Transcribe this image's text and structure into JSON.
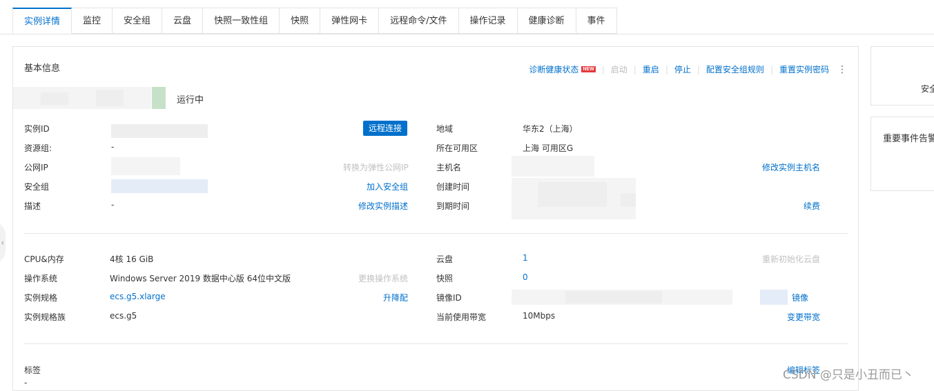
{
  "tabs": [
    {
      "label": "实例详情",
      "active": true
    },
    {
      "label": "监控"
    },
    {
      "label": "安全组"
    },
    {
      "label": "云盘"
    },
    {
      "label": "快照一致性组"
    },
    {
      "label": "快照"
    },
    {
      "label": "弹性网卡"
    },
    {
      "label": "远程命令/文件"
    },
    {
      "label": "操作记录"
    },
    {
      "label": "健康诊断"
    },
    {
      "label": "事件"
    }
  ],
  "panel": {
    "title": "基本信息",
    "actions": {
      "diagnose": "诊断健康状态",
      "new_badge": "NEW",
      "start": "启动",
      "restart": "重启",
      "stop": "停止",
      "config_sg": "配置安全组规则",
      "reset_pwd": "重置实例密码"
    },
    "status": "运行中",
    "basic_left": {
      "instance_id": {
        "label": "实例ID",
        "button": "远程连接"
      },
      "resource_group": {
        "label": "资源组:",
        "value": "-"
      },
      "public_ip": {
        "label": "公网IP",
        "action": "转换为弹性公网IP"
      },
      "security_group": {
        "label": "安全组",
        "action": "加入安全组"
      },
      "description": {
        "label": "描述",
        "value": "-",
        "action": "修改实例描述"
      }
    },
    "basic_right": {
      "region": {
        "label": "地域",
        "value": "华东2（上海）"
      },
      "zone": {
        "label": "所在可用区",
        "value": "上海 可用区G"
      },
      "hostname": {
        "label": "主机名",
        "action": "修改实例主机名"
      },
      "created": {
        "label": "创建时间"
      },
      "expire": {
        "label": "到期时间",
        "action": "续费"
      }
    },
    "spec_left": {
      "cpu_mem": {
        "label": "CPU&内存",
        "value": "4核 16 GiB"
      },
      "os": {
        "label": "操作系统",
        "value": "Windows Server 2019 数据中心版 64位中文版",
        "action": "更换操作系统"
      },
      "spec": {
        "label": "实例规格",
        "value": "ecs.g5.xlarge",
        "action": "升降配"
      },
      "family": {
        "label": "实例规格族",
        "value": "ecs.g5"
      }
    },
    "spec_right": {
      "disk": {
        "label": "云盘",
        "value": "1",
        "action": "重新初始化云盘"
      },
      "snapshot": {
        "label": "快照",
        "value": "0"
      },
      "image": {
        "label": "镜像ID",
        "action": "镜像"
      },
      "bandwidth": {
        "label": "当前使用带宽",
        "value": "10Mbps",
        "action": "变更带宽"
      }
    },
    "tags": {
      "label": "标签",
      "value": "-",
      "action": "编辑标签"
    }
  },
  "side": {
    "card1_text": "安全",
    "card2_text": "重要事件告警"
  },
  "watermark": "CSDN @只是小丑而已丶",
  "colors": {
    "primary": "#0070cc",
    "badge": "#e4393c"
  }
}
